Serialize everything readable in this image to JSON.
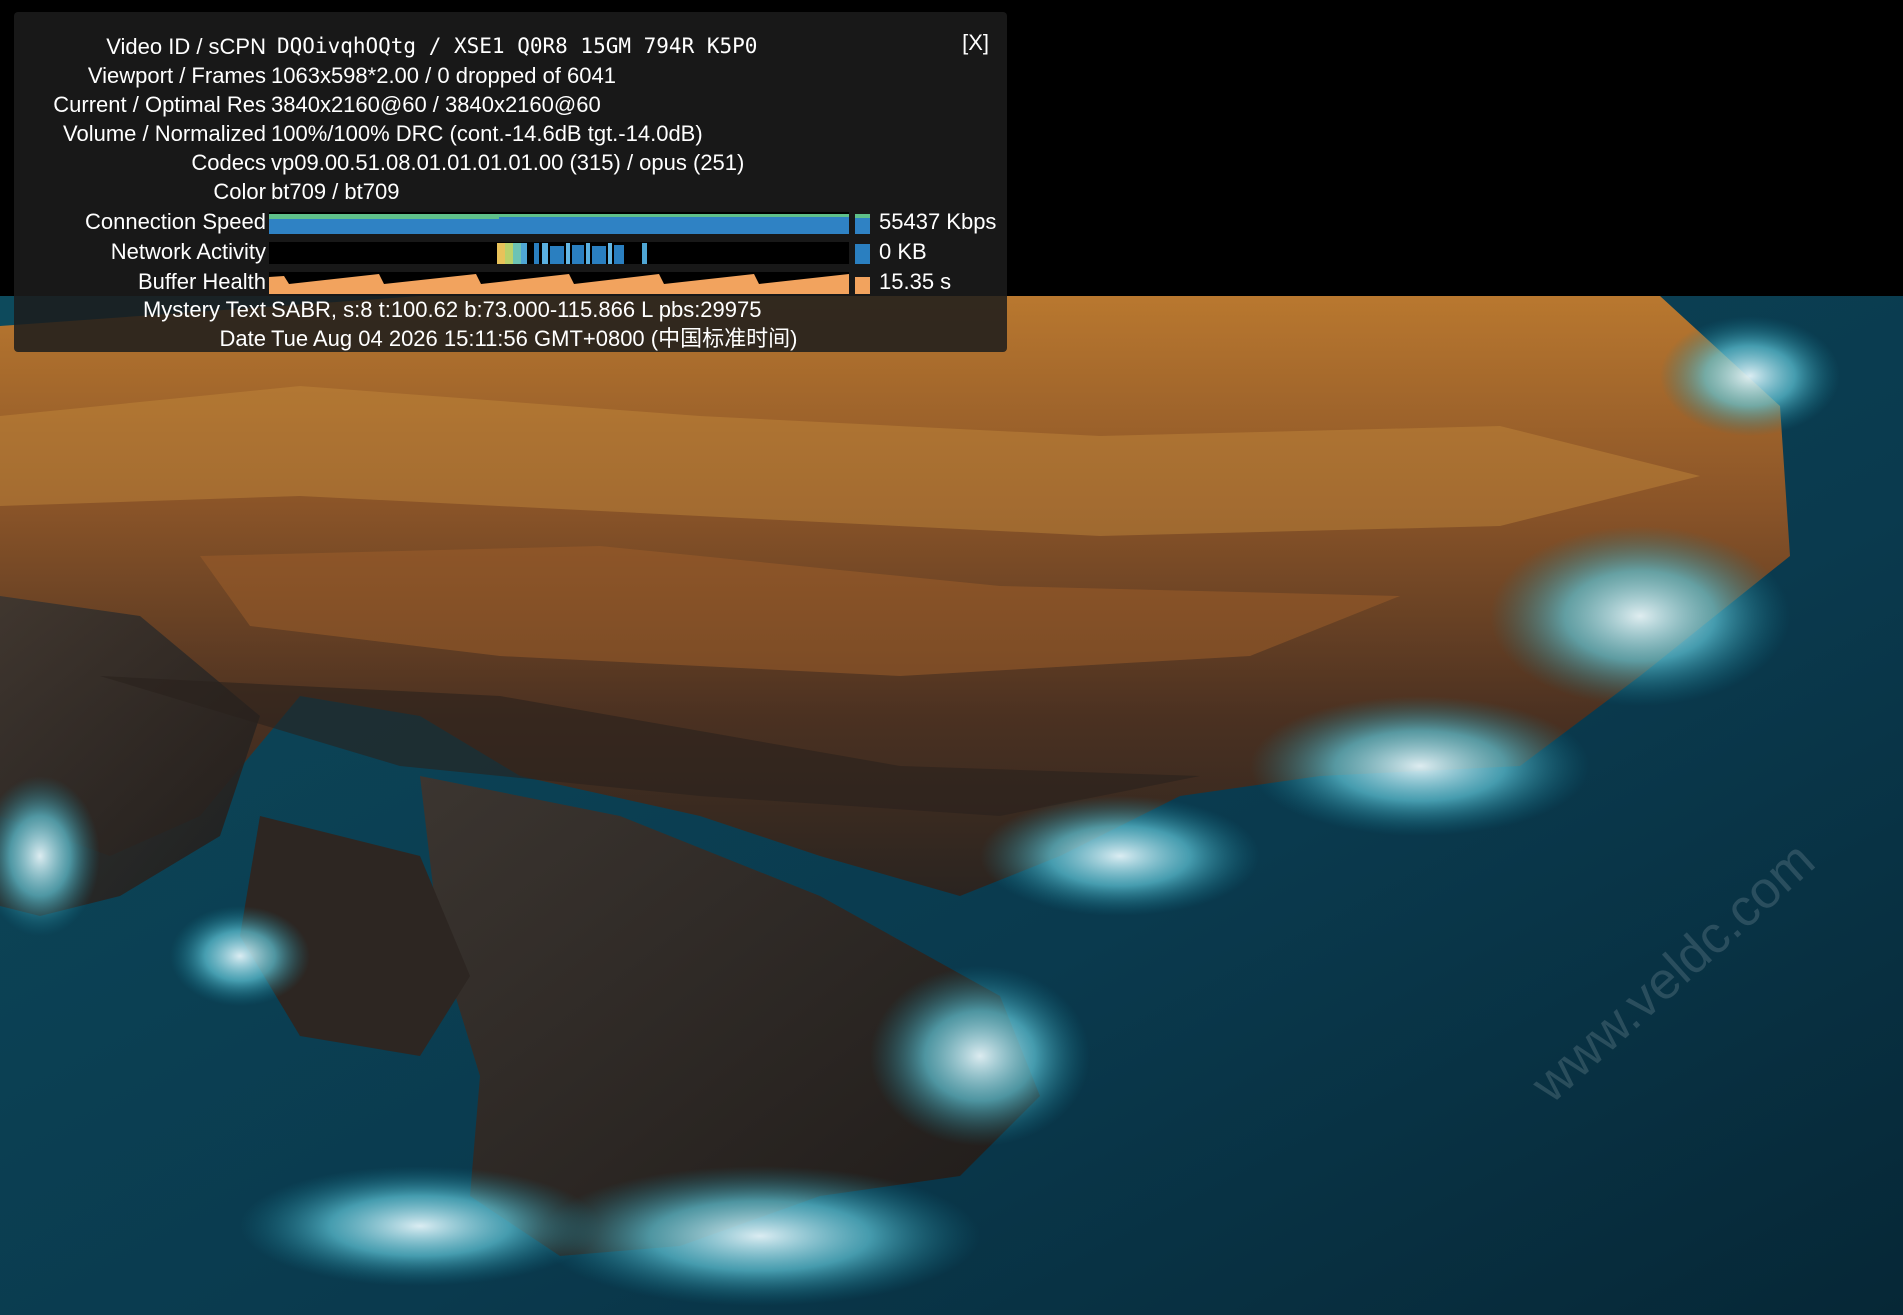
{
  "panel": {
    "close_label": "[X]",
    "rows": [
      {
        "label": "Video ID / sCPN",
        "value": "DQOivqhOQtg  /  XSE1 Q0R8 15GM 794R K5P0"
      },
      {
        "label": "Viewport / Frames",
        "value": "1063x598*2.00 / 0 dropped of 6041"
      },
      {
        "label": "Current / Optimal Res",
        "value": "3840x2160@60 / 3840x2160@60"
      },
      {
        "label": "Volume / Normalized",
        "value": "100%/100% DRC (cont.-14.6dB tgt.-14.0dB)"
      },
      {
        "label": "Codecs",
        "value": "vp09.00.51.08.01.01.01.01.00 (315) / opus (251)"
      },
      {
        "label": "Color",
        "value": "bt709 / bt709"
      }
    ],
    "graphs": {
      "connection_speed": {
        "label": "Connection Speed",
        "value": "55437 Kbps"
      },
      "network_activity": {
        "label": "Network Activity",
        "value": "0 KB"
      },
      "buffer_health": {
        "label": "Buffer Health",
        "value": "15.35 s"
      }
    },
    "rows_after": [
      {
        "label": "Mystery Text",
        "value": "SABR, s:8 t:100.62 b:73.000-115.866 L pbs:29975"
      },
      {
        "label": "Date",
        "value": "Tue Aug 04 2026 15:11:56 GMT+0800 (中国标准时间)"
      }
    ]
  },
  "watermark": "www.veldc.com",
  "colors": {
    "speed_bar": "#2f82c4",
    "speed_top": "#5fc08a",
    "buffer_bar": "#f2a35e",
    "network_bar": "#2a7fc0"
  }
}
